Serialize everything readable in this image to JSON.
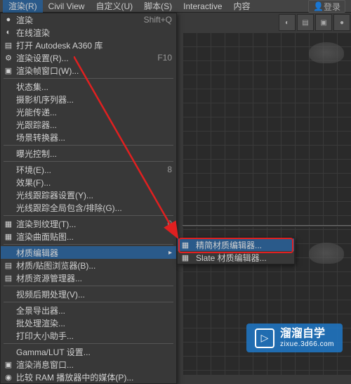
{
  "menubar": {
    "items": [
      {
        "label": "渲染(R)",
        "active": true
      },
      {
        "label": "Civil View"
      },
      {
        "label": "自定义(U)"
      },
      {
        "label": "脚本(S)"
      },
      {
        "label": "Interactive"
      },
      {
        "label": "内容"
      }
    ]
  },
  "user": {
    "label": "登录"
  },
  "dropdown": {
    "items": [
      {
        "label": "渲染",
        "shortcut": "Shift+Q",
        "icon": "●"
      },
      {
        "label": "在线渲染",
        "icon": "◐"
      },
      {
        "label": "打开 Autodesk A360 库",
        "icon": "▤"
      },
      {
        "label": "渲染设置(R)...",
        "shortcut": "F10",
        "icon": "⚙"
      },
      {
        "label": "渲染帧窗口(W)...",
        "icon": "▣"
      },
      {
        "sep": true
      },
      {
        "label": "状态集..."
      },
      {
        "label": "摄影机序列器..."
      },
      {
        "label": "光能传递..."
      },
      {
        "label": "光跟踪器..."
      },
      {
        "label": "场景转换器..."
      },
      {
        "sep": true
      },
      {
        "label": "曝光控制..."
      },
      {
        "sep": true
      },
      {
        "label": "环境(E)...",
        "shortcut": "8"
      },
      {
        "label": "效果(F)..."
      },
      {
        "label": "光线跟踪器设置(Y)..."
      },
      {
        "label": "光线跟踪全局包含/排除(G)..."
      },
      {
        "sep": true
      },
      {
        "label": "渲染到纹理(T)...",
        "shortcut": "0",
        "icon": "▦"
      },
      {
        "label": "渲染曲面贴图...",
        "icon": "▦"
      },
      {
        "sep": true
      },
      {
        "label": "材质编辑器",
        "submenu": true,
        "highlighted": true
      },
      {
        "label": "材质/贴图浏览器(B)...",
        "icon": "▤"
      },
      {
        "label": "材质资源管理器...",
        "icon": "▤"
      },
      {
        "sep": true
      },
      {
        "label": "视频后期处理(V)..."
      },
      {
        "sep": true
      },
      {
        "label": "全景导出器..."
      },
      {
        "label": "批处理渲染..."
      },
      {
        "label": "打印大小助手..."
      },
      {
        "sep": true
      },
      {
        "label": "Gamma/LUT 设置..."
      },
      {
        "label": "渲染消息窗口...",
        "icon": "▣"
      },
      {
        "label": "比较 RAM 播放器中的媒体(P)...",
        "icon": "◉"
      }
    ]
  },
  "submenu": {
    "items": [
      {
        "label": "精简材质编辑器...",
        "icon": "▦",
        "highlighted": true
      },
      {
        "label": "Slate 材质编辑器...",
        "icon": "▦"
      }
    ]
  },
  "watermark": {
    "title": "溜溜自学",
    "subtitle": "zixue.3d66.com"
  }
}
